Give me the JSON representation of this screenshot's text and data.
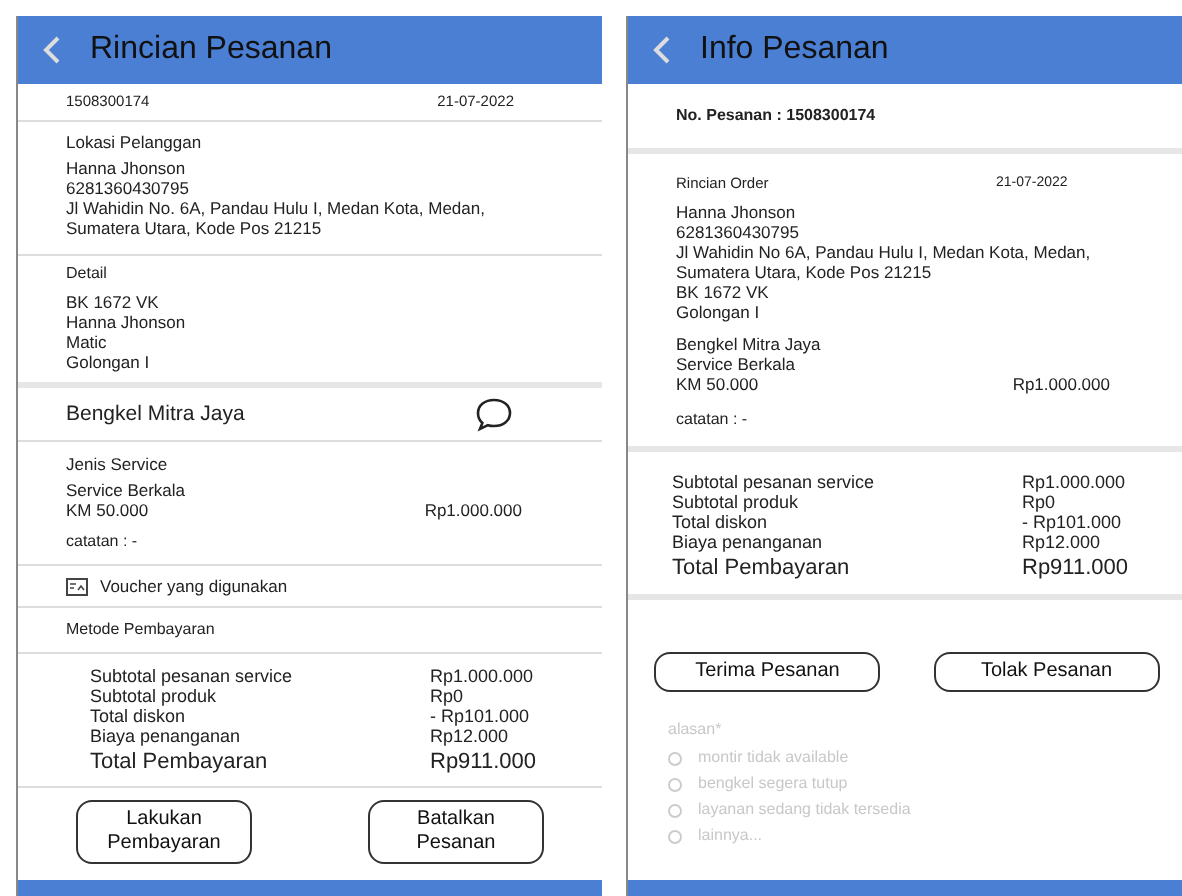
{
  "left_screen": {
    "title": "Rincian Pesanan",
    "order_number": "1508300174",
    "date": "21-07-2022",
    "customer_location": {
      "heading": "Lokasi Pelanggan",
      "lines": [
        "Hanna Jhonson",
        "6281360430795",
        "Jl Wahidin No. 6A, Pandau Hulu I, Medan Kota, Medan, Sumatera Utara, Kode Pos 21215"
      ]
    },
    "detail": {
      "heading": "Detail",
      "lines": [
        "BK 1672 VK",
        "Hanna Jhonson",
        "Matic",
        "Golongan I"
      ]
    },
    "workshop": "Bengkel Mitra Jaya",
    "service": {
      "heading": "Jenis Service",
      "name": "Service Berkala",
      "km": "KM 50.000",
      "price": "Rp1.000.000",
      "note": "catatan : -"
    },
    "voucher": "Voucher yang digunakan",
    "payment_method": "Metode Pembayaran",
    "summary": [
      {
        "label": "Subtotal pesanan service",
        "value": "Rp1.000.000"
      },
      {
        "label": "Subtotal produk",
        "value": "Rp0"
      },
      {
        "label": "Total diskon",
        "value": "- Rp101.000"
      },
      {
        "label": "Biaya penanganan",
        "value": "Rp12.000"
      }
    ],
    "total": {
      "label": "Total Pembayaran",
      "value": "Rp911.000"
    },
    "buttons": [
      {
        "label": "Lakukan Pembayaran"
      },
      {
        "label": "Batalkan Pesanan"
      }
    ]
  },
  "right_screen": {
    "title": "Info Pesanan",
    "order_number": "No. Pesanan : 1508300174",
    "order_details": {
      "heading": "Rincian Order",
      "date": "21-07-2022",
      "lines": [
        "Hanna Jhonson",
        "6281360430795",
        "Jl Wahidin No 6A, Pandau Hulu I, Medan Kota, Medan, Sumatera Utara, Kode Pos 21215",
        "BK 1672 VK",
        "Golongan I"
      ]
    },
    "workshop_lines": [
      "Bengkel Mitra Jaya",
      "Service Berkala"
    ],
    "km": "KM 50.000",
    "price": "Rp1.000.000",
    "note": "catatan : -",
    "summary": [
      {
        "label": "Subtotal pesanan service",
        "value": "Rp1.000.000"
      },
      {
        "label": "Subtotal produk",
        "value": "Rp0"
      },
      {
        "label": "Total diskon",
        "value": "- Rp101.000"
      },
      {
        "label": "Biaya penanganan",
        "value": "Rp12.000"
      }
    ],
    "total": {
      "label": "Total Pembayaran",
      "value": "Rp911.000"
    },
    "buttons": [
      {
        "label": "Terima Pesanan"
      },
      {
        "label": "Tolak Pesanan"
      }
    ],
    "reason": {
      "label": "alasan*",
      "disabled": true,
      "options": [
        {
          "label": "montir tidak available",
          "selected": false
        },
        {
          "label": "bengkel segera tutup",
          "selected": false
        },
        {
          "label": "layanan sedang tidak tersedia",
          "selected": false
        },
        {
          "label": "lainnya...",
          "selected": false
        }
      ]
    }
  }
}
